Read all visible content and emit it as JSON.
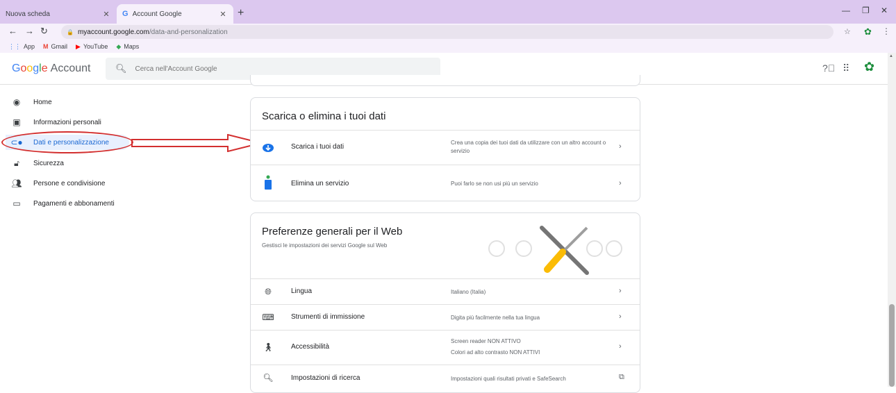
{
  "browser": {
    "tabs": [
      {
        "title": "Nuova scheda"
      },
      {
        "title": "Account Google",
        "favicon": "G"
      }
    ],
    "url_host": "myaccount.google.com",
    "url_path": "/data-and-personalization",
    "bookmarks": [
      {
        "label": "App",
        "icon": "apps-grid-icon"
      },
      {
        "label": "Gmail",
        "icon": "gmail-icon"
      },
      {
        "label": "YouTube",
        "icon": "youtube-icon"
      },
      {
        "label": "Maps",
        "icon": "maps-icon"
      }
    ]
  },
  "header": {
    "logo_google": "Google",
    "logo_account": "Account",
    "search_placeholder": "Cerca nell'Account Google"
  },
  "sidebar": {
    "items": [
      {
        "label": "Home",
        "icon": "account-circle-icon"
      },
      {
        "label": "Informazioni personali",
        "icon": "id-card-icon"
      },
      {
        "label": "Dati e personalizzazione",
        "icon": "toggle-icon",
        "active": true
      },
      {
        "label": "Sicurezza",
        "icon": "lock-icon"
      },
      {
        "label": "Persone e condivisione",
        "icon": "people-icon"
      },
      {
        "label": "Pagamenti e abbonamenti",
        "icon": "credit-card-icon"
      }
    ]
  },
  "download_card": {
    "title": "Scarica o elimina i tuoi dati",
    "rows": [
      {
        "label": "Scarica i tuoi dati",
        "desc": "Crea una copia dei tuoi dati da utilizzare con un altro account o servizio",
        "icon": "cloud-download-icon"
      },
      {
        "label": "Elimina un servizio",
        "desc": "Puoi farlo se non usi più un servizio",
        "icon": "trash-bin-icon"
      }
    ]
  },
  "web_prefs_card": {
    "title": "Preferenze generali per il Web",
    "subtitle": "Gestisci le impostazioni dei servizi Google sul Web",
    "rows": [
      {
        "label": "Lingua",
        "desc": "Italiano (Italia)",
        "icon": "globe-icon"
      },
      {
        "label": "Strumenti di immissione",
        "desc": "Digita più facilmente nella tua lingua",
        "icon": "keyboard-icon"
      },
      {
        "label": "Accessibilità",
        "desc_line1": "Screen reader NON ATTIVO",
        "desc_line2": "Colori ad alto contrasto NON ATTIVI",
        "icon": "accessibility-icon"
      },
      {
        "label": "Impostazioni di ricerca",
        "desc": "Impostazioni quali risultati privati e SafeSearch",
        "icon": "search-icon"
      }
    ]
  },
  "colors": {
    "accent": "#1967d2",
    "annotation": "#d32f2f",
    "tab_strip": "#dcc8ef"
  }
}
